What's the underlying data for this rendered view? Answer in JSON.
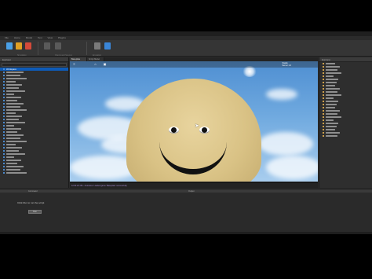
{
  "ribbon": {
    "tabs": [
      "File",
      "Home",
      "Model",
      "Test",
      "View",
      "Plugins"
    ],
    "buttons": [
      {
        "label": "Play",
        "color": "#4aa0e6"
      },
      {
        "label": "Resume",
        "color": "#e0a024"
      },
      {
        "label": "Stop",
        "color": "#d44a3a"
      },
      {
        "label": "Scripting",
        "color": "#7b7b7b"
      },
      {
        "label": "Explorer",
        "color": "#3a86d8"
      }
    ],
    "groups": [
      "Simulation",
      "Clients and Servers",
      "Emulation"
    ]
  },
  "explorer": {
    "title": "Explorer",
    "selected_item": "Workspace"
  },
  "properties": {
    "title": "Explorer"
  },
  "doc_tabs": [
    {
      "label": "Baseplate",
      "active": true
    },
    {
      "label": "Script Model",
      "active": false
    }
  ],
  "viewport": {
    "info_line1": "Studio",
    "info_line2": "Server 1.0"
  },
  "output": {
    "title": "Output",
    "message": "12:04:22.161 - Autosave: Loaded game 'Baseplate' successfully"
  },
  "command_bar": {
    "label": "Command",
    "text": "Click Run to run the script",
    "button_label": "Run"
  }
}
